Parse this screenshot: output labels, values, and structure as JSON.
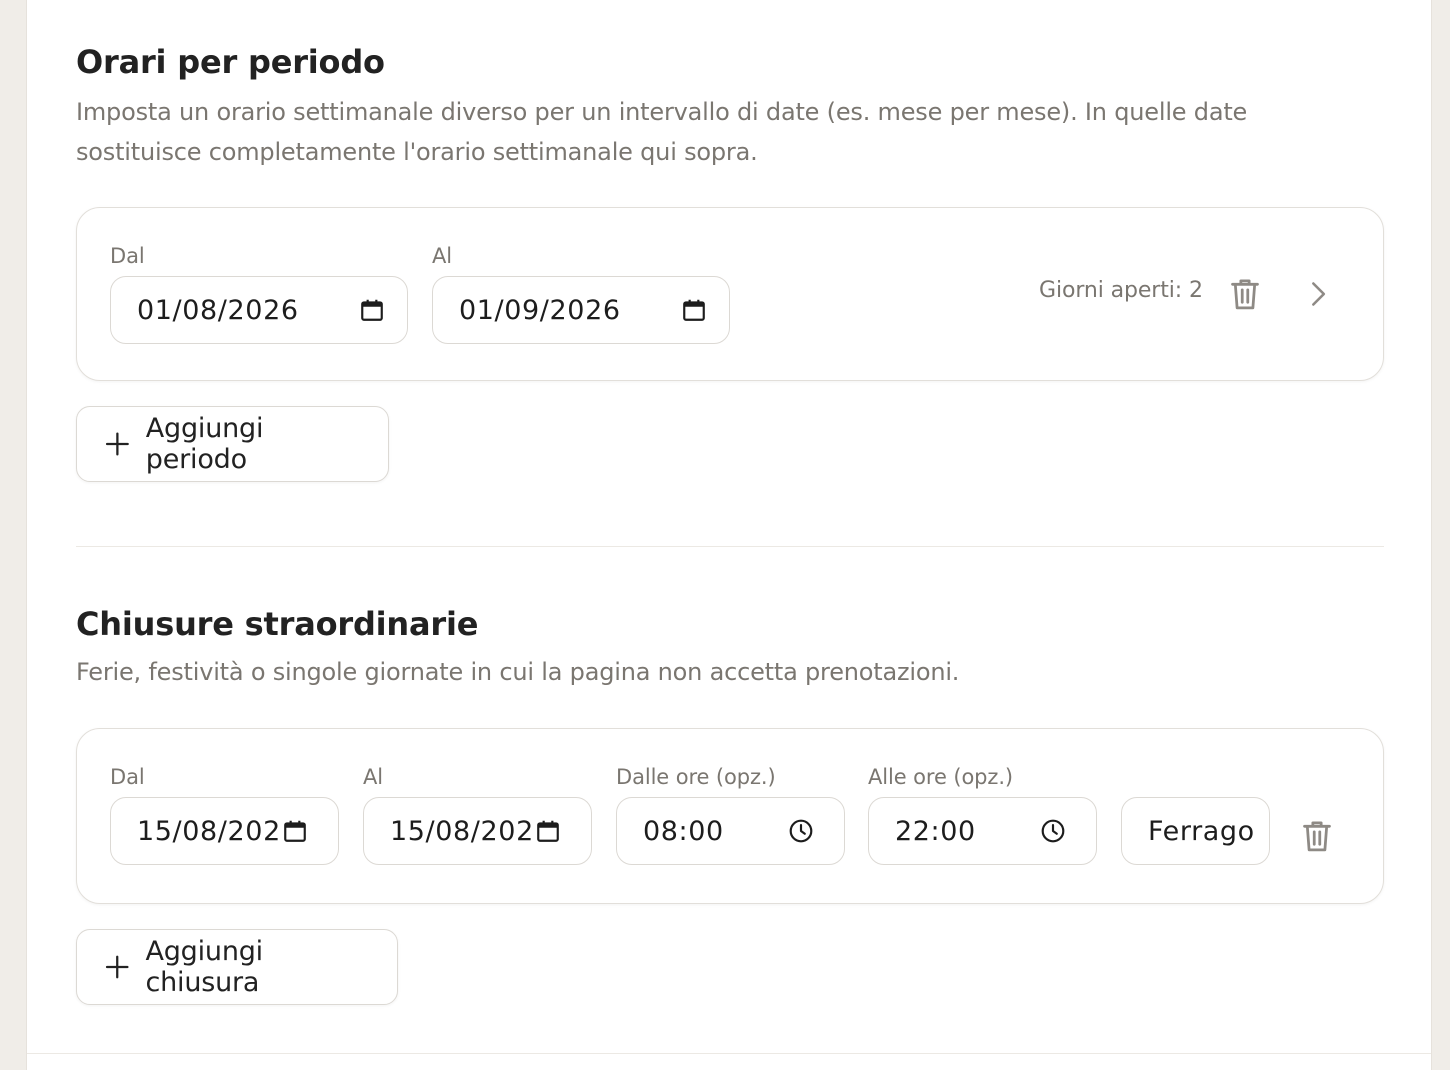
{
  "period_section": {
    "title": "Orari per periodo",
    "description_line1": "Imposta un orario settimanale diverso per un intervallo di date (es. mese per mese). In quelle date",
    "description_line2": "sostituisce completamente l'orario settimanale qui sopra.",
    "rows": [
      {
        "from_label": "Dal",
        "from_value": "01/08/2026",
        "to_label": "Al",
        "to_value": "01/09/2026",
        "open_days_text": "Giorni aperti: 2",
        "icons": [
          "calendar-icon",
          "calendar-icon",
          "trash-icon",
          "chevron-right-icon"
        ]
      }
    ],
    "add_button_label": "Aggiungi periodo"
  },
  "closures_section": {
    "title": "Chiusure straordinarie",
    "description": "Ferie, festività o singole giornate in cui la pagina non accetta prenotazioni.",
    "rows": [
      {
        "from_label": "Dal",
        "from_value": "15/08/202",
        "to_label": "Al",
        "to_value": "15/08/202",
        "time_from_label": "Dalle ore (opz.)",
        "time_from_value": "08:00",
        "time_to_label": "Alle ore (opz.)",
        "time_to_value": "22:00",
        "note_value": "Ferrago",
        "icons": [
          "calendar-icon",
          "calendar-icon",
          "clock-icon",
          "clock-icon",
          "trash-icon"
        ]
      }
    ],
    "add_button_label": "Aggiungi chiusura"
  },
  "colors": {
    "background": "#f0ede8",
    "panel": "#ffffff",
    "muted_text": "#7a7670",
    "border": "#dcd9d4",
    "icon_gray": "#8e8a85"
  }
}
